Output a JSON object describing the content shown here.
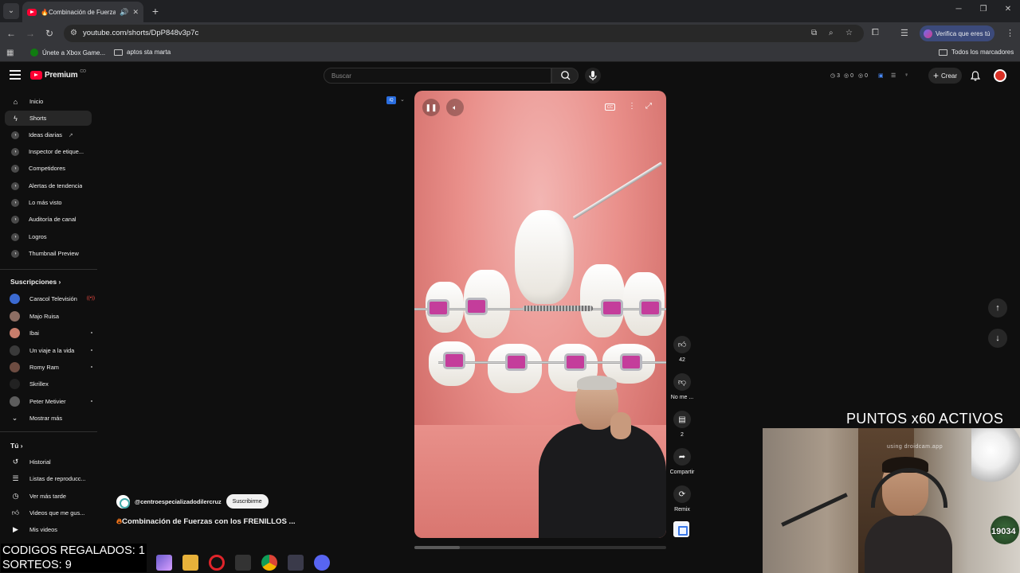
{
  "browser": {
    "tab_title": "🔥Combinación de Fuerzas",
    "url": "youtube.com/shorts/DpP848v3p7c",
    "verify_label": "Verifica que eres tú",
    "bookmarks": [
      "Únete a Xbox Game...",
      "aptos sta marta"
    ],
    "all_bookmarks": "Todos los marcadores"
  },
  "header": {
    "logo_text": "Premium",
    "logo_sup": "CO",
    "search_placeholder": "Buscar",
    "stats": [
      "3",
      "0",
      "0"
    ],
    "create_label": "Crear"
  },
  "sidebar": {
    "items": [
      {
        "label": "Inicio"
      },
      {
        "label": "Shorts"
      },
      {
        "label": "Ideas diarias"
      },
      {
        "label": "Inspector de etique..."
      },
      {
        "label": "Competidores"
      },
      {
        "label": "Alertas de tendencia"
      },
      {
        "label": "Lo más visto"
      },
      {
        "label": "Auditoría de canal"
      },
      {
        "label": "Logros"
      },
      {
        "label": "Thumbnail Preview"
      }
    ],
    "subscriptions_title": "Suscripciones",
    "subscriptions": [
      {
        "label": "Caracol Televisión",
        "color": "#3b6ad1"
      },
      {
        "label": "Majo Ruisa",
        "color": "#8d6e63"
      },
      {
        "label": "Ibai",
        "color": "#c77d6b"
      },
      {
        "label": "Un viaje a la vida",
        "color": "#3a3a3a"
      },
      {
        "label": "Romy Ram",
        "color": "#6d4c41"
      },
      {
        "label": "Skrillex",
        "color": "#222222"
      },
      {
        "label": "Peter Metivier",
        "color": "#5d5d5d"
      }
    ],
    "show_more": "Mostrar más",
    "you_title": "Tú",
    "you_items": [
      {
        "label": "Historial"
      },
      {
        "label": "Listas de reproducc..."
      },
      {
        "label": "Ver más tarde"
      },
      {
        "label": "Videos que me gus..."
      },
      {
        "label": "Mis videos"
      }
    ]
  },
  "short": {
    "channel": "@centroespecializadodilercruz",
    "subscribe_label": "Suscribirme",
    "title": "Combinación de Fuerzas con los FRENILLOS ...",
    "progress": 0.18,
    "actions": {
      "likes": "42",
      "dislike_label": "No me ...",
      "comments": "2",
      "share_label": "Compartir",
      "remix_label": "Remix"
    }
  },
  "overlay": {
    "promo": "PUNTOS x60 ACTIVOS",
    "codes": "CODIGOS REGALADOS: 1",
    "raffles": "SORTEOS: 9",
    "watermark": "using droidcam.app",
    "hp_value": "19034"
  }
}
